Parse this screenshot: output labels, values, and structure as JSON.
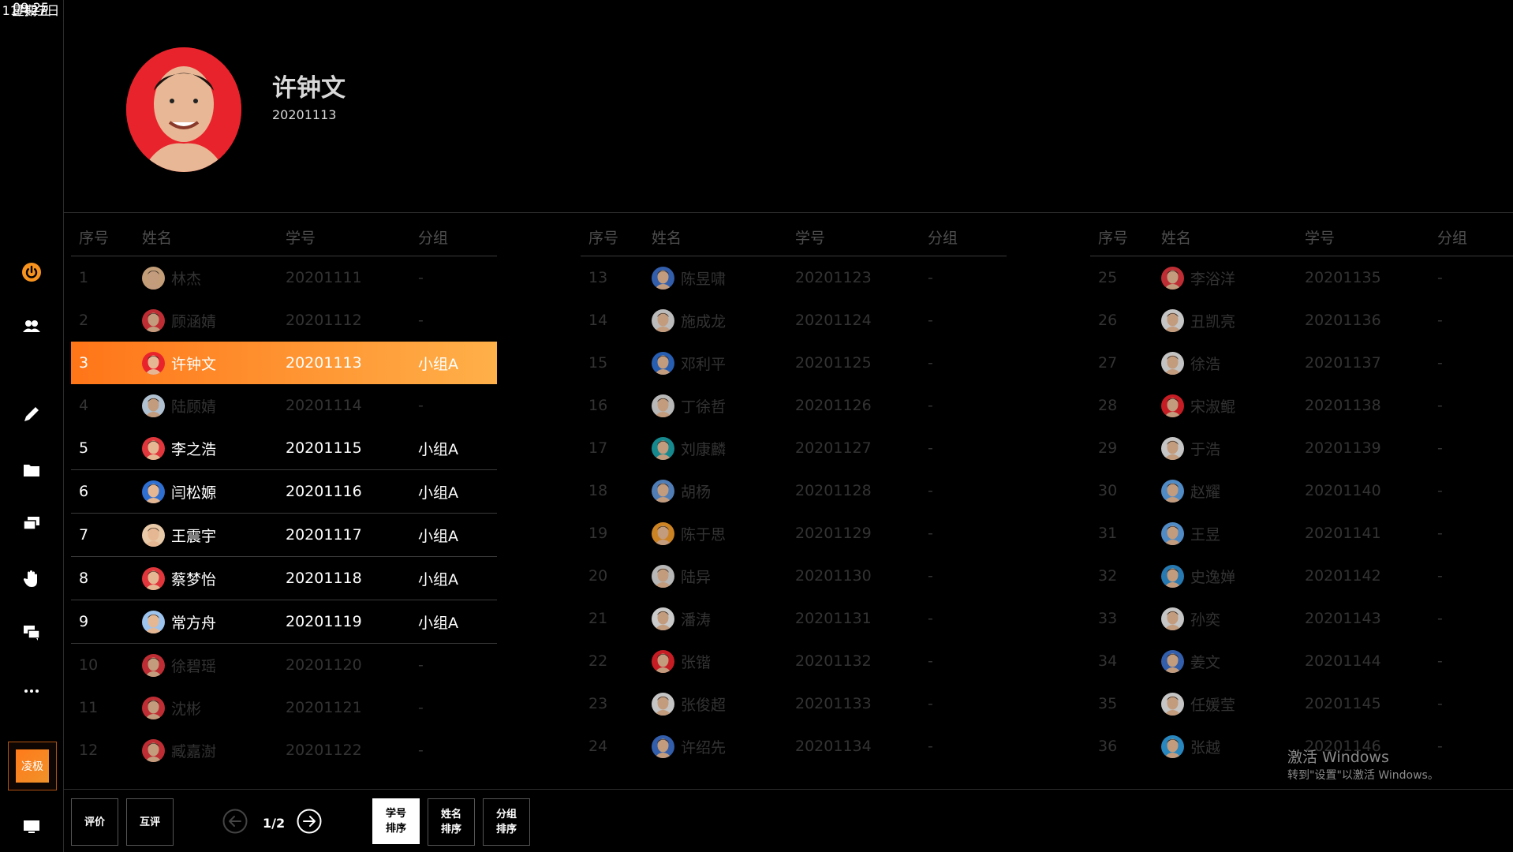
{
  "clock": {
    "time": "09:25",
    "date": "11月27日",
    "weekday": "星期五"
  },
  "sidebar": {
    "icons": [
      "power-icon",
      "users-icon",
      "pencil-icon",
      "folder-icon",
      "screens-icon",
      "hand-icon",
      "chat-icon",
      "more-icon"
    ],
    "board_label": "凌极",
    "accent_color": "#f7931e"
  },
  "profile": {
    "name": "许钟文",
    "student_id": "20201113"
  },
  "table": {
    "headers": {
      "seq": "序号",
      "name": "姓名",
      "id": "学号",
      "group": "分组"
    },
    "columns": [
      [
        {
          "seq": "1",
          "name": "林杰",
          "id": "20201111",
          "group": "-",
          "state": "dim",
          "c": "#e4b98d"
        },
        {
          "seq": "2",
          "name": "顾涵婧",
          "id": "20201112",
          "group": "-",
          "state": "dim",
          "c": "#e0363c"
        },
        {
          "seq": "3",
          "name": "许钟文",
          "id": "20201113",
          "group": "小组A",
          "state": "selected",
          "c": "#e9232b"
        },
        {
          "seq": "4",
          "name": "陆顾婧",
          "id": "20201114",
          "group": "-",
          "state": "dim",
          "c": "#cfe4f7"
        },
        {
          "seq": "5",
          "name": "李之浩",
          "id": "20201115",
          "group": "小组A",
          "state": "active",
          "c": "#e0363c"
        },
        {
          "seq": "6",
          "name": "闫松嫄",
          "id": "20201116",
          "group": "小组A",
          "state": "active",
          "c": "#2e6fd1"
        },
        {
          "seq": "7",
          "name": "王震宇",
          "id": "20201117",
          "group": "小组A",
          "state": "active",
          "c": "#e8c9a8"
        },
        {
          "seq": "8",
          "name": "蔡梦怡",
          "id": "20201118",
          "group": "小组A",
          "state": "active",
          "c": "#e0363c"
        },
        {
          "seq": "9",
          "name": "常方舟",
          "id": "20201119",
          "group": "小组A",
          "state": "active",
          "c": "#9cc4ef"
        },
        {
          "seq": "10",
          "name": "徐碧瑶",
          "id": "20201120",
          "group": "-",
          "state": "dim",
          "c": "#e0363c"
        },
        {
          "seq": "11",
          "name": "沈彬",
          "id": "20201121",
          "group": "-",
          "state": "dim",
          "c": "#e0363c"
        },
        {
          "seq": "12",
          "name": "臧嘉澍",
          "id": "20201122",
          "group": "-",
          "state": "dim",
          "c": "#e0363c"
        }
      ],
      [
        {
          "seq": "13",
          "name": "陈昱啸",
          "id": "20201123",
          "group": "-",
          "state": "dim",
          "c": "#3b6fc9"
        },
        {
          "seq": "14",
          "name": "施成龙",
          "id": "20201124",
          "group": "-",
          "state": "dim",
          "c": "#dcdcdc"
        },
        {
          "seq": "15",
          "name": "邓利平",
          "id": "20201125",
          "group": "-",
          "state": "dim",
          "c": "#2e6fd1"
        },
        {
          "seq": "16",
          "name": "丁徐哲",
          "id": "20201126",
          "group": "-",
          "state": "dim",
          "c": "#d9d9d9"
        },
        {
          "seq": "17",
          "name": "刘康麟",
          "id": "20201127",
          "group": "-",
          "state": "dim",
          "c": "#1aa1a8"
        },
        {
          "seq": "18",
          "name": "胡杨",
          "id": "20201128",
          "group": "-",
          "state": "dim",
          "c": "#5f93d6"
        },
        {
          "seq": "19",
          "name": "陈于思",
          "id": "20201129",
          "group": "-",
          "state": "dim",
          "c": "#f09a2a"
        },
        {
          "seq": "20",
          "name": "陆异",
          "id": "20201130",
          "group": "-",
          "state": "dim",
          "c": "#d8d8d8"
        },
        {
          "seq": "21",
          "name": "潘涛",
          "id": "20201131",
          "group": "-",
          "state": "dim",
          "c": "#eeeeee"
        },
        {
          "seq": "22",
          "name": "张锴",
          "id": "20201132",
          "group": "-",
          "state": "dim",
          "c": "#e9232b"
        },
        {
          "seq": "23",
          "name": "张俊超",
          "id": "20201133",
          "group": "-",
          "state": "dim",
          "c": "#e8e8e8"
        },
        {
          "seq": "24",
          "name": "许绍先",
          "id": "20201134",
          "group": "-",
          "state": "dim",
          "c": "#3b6fc9"
        }
      ],
      [
        {
          "seq": "25",
          "name": "李浴洋",
          "id": "20201135",
          "group": "-",
          "state": "dim",
          "c": "#e0363c"
        },
        {
          "seq": "26",
          "name": "丑凯亮",
          "id": "20201136",
          "group": "-",
          "state": "dim",
          "c": "#e8e8e8"
        },
        {
          "seq": "27",
          "name": "徐浩",
          "id": "20201137",
          "group": "-",
          "state": "dim",
          "c": "#e6e6e6"
        },
        {
          "seq": "28",
          "name": "宋淑鲲",
          "id": "20201138",
          "group": "-",
          "state": "dim",
          "c": "#e9232b"
        },
        {
          "seq": "29",
          "name": "于浩",
          "id": "20201139",
          "group": "-",
          "state": "dim",
          "c": "#e8e8e8"
        },
        {
          "seq": "30",
          "name": "赵耀",
          "id": "20201140",
          "group": "-",
          "state": "dim",
          "c": "#5fa4e8"
        },
        {
          "seq": "31",
          "name": "王昱",
          "id": "20201141",
          "group": "-",
          "state": "dim",
          "c": "#5fa4e8"
        },
        {
          "seq": "32",
          "name": "史逸婵",
          "id": "20201142",
          "group": "-",
          "state": "dim",
          "c": "#2e8fd1"
        },
        {
          "seq": "33",
          "name": "孙奕",
          "id": "20201143",
          "group": "-",
          "state": "dim",
          "c": "#e8e8e8"
        },
        {
          "seq": "34",
          "name": "姜文",
          "id": "20201144",
          "group": "-",
          "state": "dim",
          "c": "#3b6fc9"
        },
        {
          "seq": "35",
          "name": "任媛莹",
          "id": "20201145",
          "group": "-",
          "state": "dim",
          "c": "#e8e8e8"
        },
        {
          "seq": "36",
          "name": "张越",
          "id": "20201146",
          "group": "-",
          "state": "dim",
          "c": "#2e9fe0"
        }
      ]
    ]
  },
  "bottom": {
    "evaluate": "评价",
    "peer_review": "互评",
    "page": "1/2",
    "sort_by_id": [
      "学号",
      "排序"
    ],
    "sort_by_name": [
      "姓名",
      "排序"
    ],
    "sort_by_group": [
      "分组",
      "排序"
    ]
  },
  "watermark": {
    "line1": "激活 Windows",
    "line2": "转到\"设置\"以激活 Windows。"
  }
}
